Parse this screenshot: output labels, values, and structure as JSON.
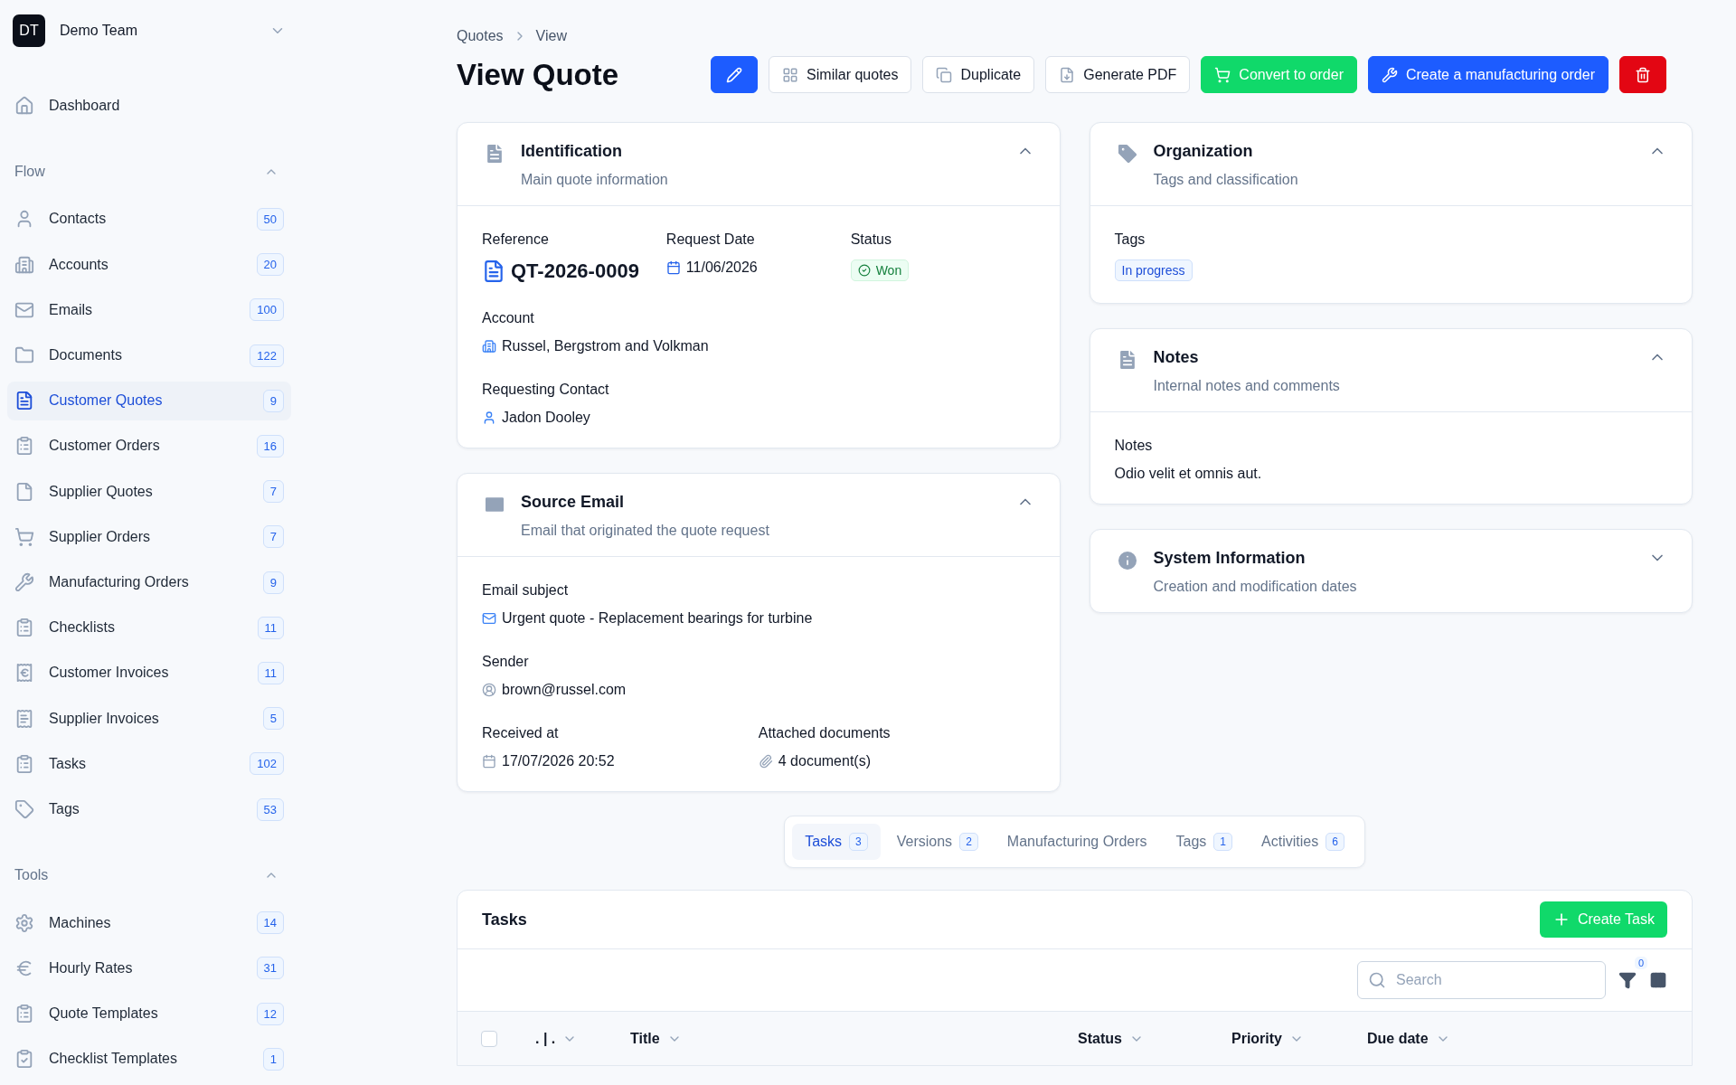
{
  "team": {
    "initials": "DT",
    "name": "Demo Team"
  },
  "sidebar": {
    "top": [
      {
        "label": "Dashboard",
        "selected": false
      }
    ],
    "sections": [
      {
        "title": "Flow",
        "expanded": true,
        "items": [
          {
            "label": "Contacts",
            "count": "50",
            "selected": false
          },
          {
            "label": "Accounts",
            "count": "20",
            "selected": false
          },
          {
            "label": "Emails",
            "count": "100",
            "selected": false
          },
          {
            "label": "Documents",
            "count": "122",
            "selected": false
          },
          {
            "label": "Customer Quotes",
            "count": "9",
            "selected": true
          },
          {
            "label": "Customer Orders",
            "count": "16",
            "selected": false
          },
          {
            "label": "Supplier Quotes",
            "count": "7",
            "selected": false
          },
          {
            "label": "Supplier Orders",
            "count": "7",
            "selected": false
          },
          {
            "label": "Manufacturing Orders",
            "count": "9",
            "selected": false
          },
          {
            "label": "Checklists",
            "count": "11",
            "selected": false
          },
          {
            "label": "Customer Invoices",
            "count": "11",
            "selected": false
          },
          {
            "label": "Supplier Invoices",
            "count": "5",
            "selected": false
          },
          {
            "label": "Tasks",
            "count": "102",
            "selected": false
          },
          {
            "label": "Tags",
            "count": "53",
            "selected": false
          }
        ]
      },
      {
        "title": "Tools",
        "expanded": true,
        "items": [
          {
            "label": "Machines",
            "count": "14",
            "selected": false
          },
          {
            "label": "Hourly Rates",
            "count": "31",
            "selected": false
          },
          {
            "label": "Quote Templates",
            "count": "12",
            "selected": false
          },
          {
            "label": "Checklist Templates",
            "count": "1",
            "selected": false
          }
        ]
      }
    ]
  },
  "breadcrumb": [
    "Quotes",
    "View"
  ],
  "title": "View Quote",
  "actions": [
    {
      "kind": "edit"
    },
    {
      "kind": "outline",
      "label": "Similar quotes"
    },
    {
      "kind": "outline",
      "label": "Duplicate"
    },
    {
      "kind": "outline",
      "label": "Generate PDF"
    },
    {
      "kind": "success",
      "label": "Convert to order"
    },
    {
      "kind": "primary",
      "label": "Create a manufacturing order"
    },
    {
      "kind": "delete"
    }
  ],
  "left_cards": [
    {
      "title": "Identification",
      "subtitle": "Main quote information",
      "expanded": true,
      "rows": [
        [
          {
            "label": "Reference",
            "kind": "reference",
            "value": "QT-2026-0009"
          },
          {
            "label": "Request Date",
            "kind": "date",
            "value": "11/06/2026"
          },
          {
            "label": "Status",
            "kind": "status",
            "value": "Won"
          }
        ],
        [
          {
            "label": "Account",
            "kind": "account",
            "value": "Russel, Bergstrom and Volkman"
          }
        ],
        [
          {
            "label": "Requesting Contact",
            "kind": "contact",
            "value": "Jadon Dooley"
          }
        ]
      ]
    },
    {
      "title": "Source Email",
      "subtitle": "Email that originated the quote request",
      "expanded": true,
      "rows": [
        [
          {
            "label": "Email subject",
            "kind": "email",
            "value": "Urgent quote - Replacement bearings for turbine"
          }
        ],
        [
          {
            "label": "Sender",
            "kind": "sender",
            "value": "brown@russel.com"
          }
        ],
        [
          {
            "label": "Received at",
            "kind": "datetime",
            "value": "17/07/2026 20:52"
          },
          {
            "label": "Attached documents",
            "kind": "attachments",
            "value": "4 document(s)"
          }
        ]
      ]
    }
  ],
  "right_cards": [
    {
      "title": "Organization",
      "subtitle": "Tags and classification",
      "expanded": true,
      "rows": [
        [
          {
            "label": "Tags",
            "kind": "tags",
            "value": "In progress"
          }
        ]
      ]
    },
    {
      "title": "Notes",
      "subtitle": "Internal notes and comments",
      "expanded": true,
      "rows": [
        [
          {
            "label": "Notes",
            "kind": "text",
            "value": "Odio velit et omnis aut."
          }
        ]
      ]
    },
    {
      "title": "System Information",
      "subtitle": "Creation and modification dates",
      "expanded": false
    }
  ],
  "tabs": [
    {
      "label": "Tasks",
      "count": "3",
      "selected": true
    },
    {
      "label": "Versions",
      "count": "2",
      "selected": false
    },
    {
      "label": "Manufacturing Orders",
      "selected": false
    },
    {
      "label": "Tags",
      "count": "1",
      "selected": false
    },
    {
      "label": "Activities",
      "count": "6",
      "selected": false
    }
  ],
  "tasks": {
    "title": "Tasks",
    "create_label": "Create Task",
    "search": {
      "placeholder": "Search"
    },
    "filter_count": "0",
    "select_all": false,
    "columns": [
      ". | .",
      "Title",
      "Status",
      "Priority",
      "Due date"
    ]
  }
}
